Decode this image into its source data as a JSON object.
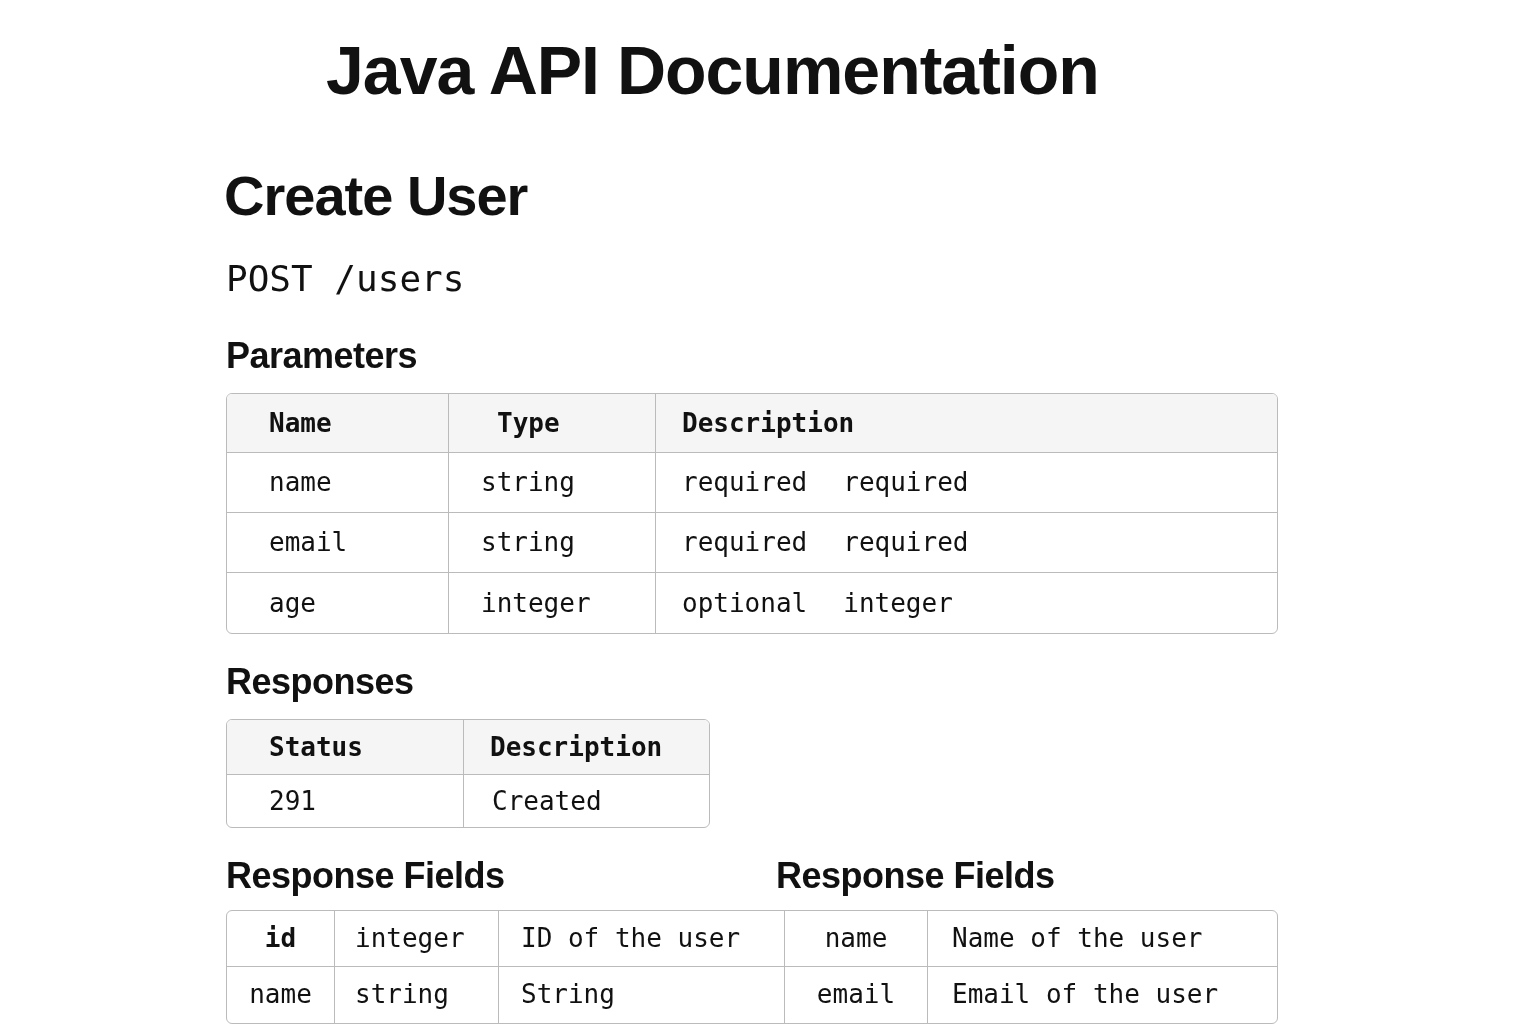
{
  "title": "Java API Documentation",
  "endpoint": {
    "name": "Create User",
    "method_path": "POST /users"
  },
  "parameters": {
    "heading": "Parameters",
    "columns": [
      "Name",
      "Type",
      "Description"
    ],
    "rows": [
      {
        "name": "name",
        "type": "string",
        "description": [
          "required",
          "required"
        ]
      },
      {
        "name": "email",
        "type": "string",
        "description": [
          "required",
          "required"
        ]
      },
      {
        "name": "age",
        "type": "integer",
        "description": [
          "optional",
          "integer"
        ]
      }
    ]
  },
  "responses": {
    "heading": "Responses",
    "columns": [
      "Status",
      "Description"
    ],
    "rows": [
      [
        "291",
        "Created"
      ]
    ]
  },
  "response_fields": {
    "headings": [
      "Response Fields",
      "Response Fields"
    ],
    "rows": [
      [
        "id",
        "integer",
        "ID of the user",
        "name",
        "Name of the user"
      ],
      [
        "name",
        "string",
        "String",
        "email",
        "Email of the user"
      ]
    ]
  }
}
